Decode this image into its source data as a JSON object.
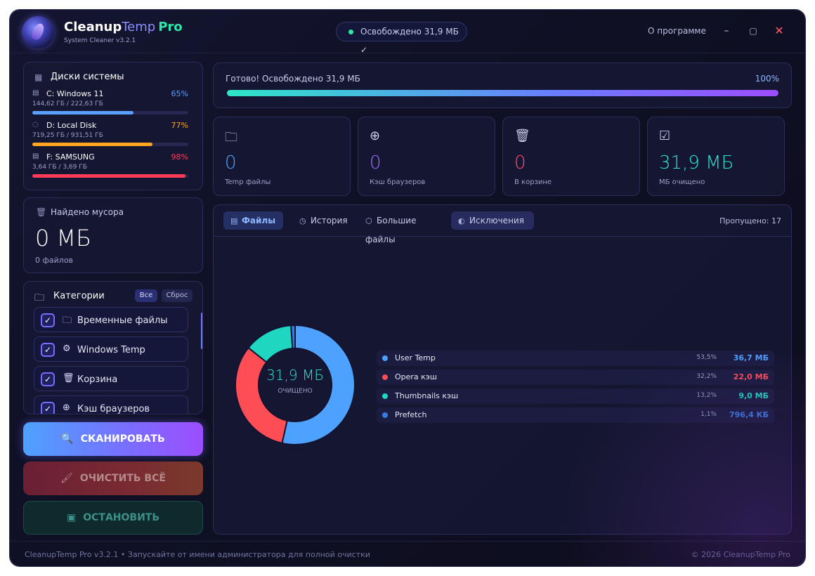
{
  "app": {
    "title_part1": "Cleanup",
    "title_part2": "Temp",
    "title_part3": "Pro",
    "version": "System Cleaner v3.2.1",
    "status": "Освобождено 31,9 МБ ✓",
    "about": "О программе"
  },
  "disks": {
    "title": "Диски системы",
    "items": [
      {
        "name": "C:  Windows 11",
        "pct": "65%",
        "size": "144,62 ГБ / 222,63 ГБ",
        "fill": 0.65,
        "color": "#5aa0ff"
      },
      {
        "name": "D:  Local Disk",
        "pct": "77%",
        "size": "719,25 ГБ / 931,51 ГБ",
        "fill": 0.77,
        "color": "#ffa51f"
      },
      {
        "name": "F:  SAMSUNG",
        "pct": "98%",
        "size": "3,64 ГБ / 3,69 ГБ",
        "fill": 0.98,
        "color": "#ff3b55"
      }
    ]
  },
  "found": {
    "title": "Найдено мусора",
    "value": "0 МБ",
    "files": "0 файлов"
  },
  "categories": {
    "title": "Категории",
    "all_label": "Все",
    "reset_label": "Сброс",
    "items": [
      {
        "label": "Временные файлы",
        "icon": "folder-icon",
        "checked": true
      },
      {
        "label": "Windows Temp",
        "icon": "gear-icon",
        "checked": true
      },
      {
        "label": "Корзина",
        "icon": "trash-icon",
        "checked": true
      },
      {
        "label": "Кэш браузеров",
        "icon": "globe-icon",
        "checked": true
      }
    ]
  },
  "buttons": {
    "scan": "СКАНИРОВАТЬ",
    "clean": "ОЧИСТИТЬ ВСЁ",
    "stop": "ОСТАНОВИТЬ"
  },
  "progress": {
    "text": "Готово! Освобождено 31,9 МБ",
    "pct_label": "100%",
    "value": 1.0
  },
  "stats": [
    {
      "value": "0",
      "label": "Temp файлы",
      "color": "#4da2ff",
      "icon": "folder-icon"
    },
    {
      "value": "0",
      "label": "Кэш браузеров",
      "color": "#9d6cff",
      "icon": "globe-icon"
    },
    {
      "value": "0",
      "label": "В корзине",
      "color": "#ff4d6a",
      "icon": "trash-icon"
    },
    {
      "value": "31,9 МБ",
      "label": "МБ очищено",
      "color": "#2ee6c8",
      "icon": "checkbox-icon"
    }
  ],
  "tabs": {
    "files": "Файлы",
    "history": "История",
    "large_files": "Большие файлы",
    "exclusions": "Исключения",
    "skipped": "Пропущено: 17"
  },
  "donut": {
    "value": "31,9 МБ",
    "sub": "ОЧИЩЕНО"
  },
  "chart_data": {
    "type": "pie",
    "categories": [
      "User Temp",
      "Opera кэш",
      "Thumbnails кэш",
      "Prefetch"
    ],
    "values": [
      53.5,
      32.2,
      13.2,
      1.1
    ],
    "pct_labels": [
      "53,5%",
      "32,2%",
      "13,2%",
      "1,1%"
    ],
    "size_labels": [
      "36,7 МБ",
      "22,0 МБ",
      "9,0 МБ",
      "796,4 КБ"
    ],
    "colors": [
      "#4da2ff",
      "#ff4d55",
      "#1fd6c0",
      "#3a7be0"
    ]
  },
  "footer": {
    "left": "CleanupTemp Pro v3.2.1  •  Запускайте от имени администратора для полной очистки",
    "right": "© 2026 CleanupTemp Pro"
  }
}
